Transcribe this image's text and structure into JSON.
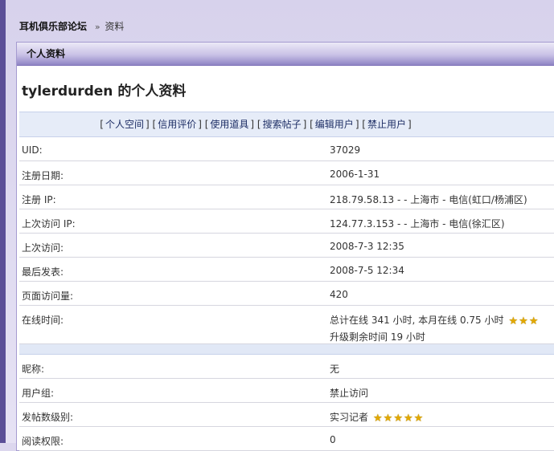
{
  "breadcrumb": {
    "forum": "耳机俱乐部论坛",
    "separator": "»",
    "current": "资料"
  },
  "panel": {
    "header": "个人资料",
    "title": "tylerdurden 的个人资料"
  },
  "actions": [
    "个人空间",
    "信用评价",
    "使用道具",
    "搜索帖子",
    "编辑用户",
    "禁止用户"
  ],
  "profile": {
    "uid": {
      "label": "UID:",
      "value": "37029"
    },
    "reg_date": {
      "label": "注册日期:",
      "value": "2006-1-31"
    },
    "reg_ip": {
      "label": "注册 IP:",
      "value": "218.79.58.13 - - 上海市 - 电信(虹口/杨浦区)"
    },
    "last_ip": {
      "label": "上次访问 IP:",
      "value": "124.77.3.153 - - 上海市 - 电信(徐汇区)"
    },
    "last_visit": {
      "label": "上次访问:",
      "value": "2008-7-3 12:35"
    },
    "last_post": {
      "label": "最后发表:",
      "value": "2008-7-5 12:34"
    },
    "page_views": {
      "label": "页面访问量:",
      "value": "420"
    },
    "online": {
      "label": "在线时间:",
      "line1": "总计在线 341 小时, 本月在线 0.75 小时",
      "line2": "升级剩余时间 19 小时",
      "stars": 3
    },
    "nickname": {
      "label": "昵称:",
      "value": "无"
    },
    "group": {
      "label": "用户组:",
      "value": "禁止访问"
    },
    "post_rank": {
      "label": "发帖数级别:",
      "value": "实习记者",
      "stars": 5
    },
    "read_perm": {
      "label": "阅读权限:",
      "value": "0"
    }
  },
  "colors": {
    "accent": "#5b4f97",
    "panel_header": "#c9c1e6",
    "action_bar": "#e6ecf8",
    "star": "#e2a800"
  },
  "icons": {
    "star": "star-icon"
  }
}
